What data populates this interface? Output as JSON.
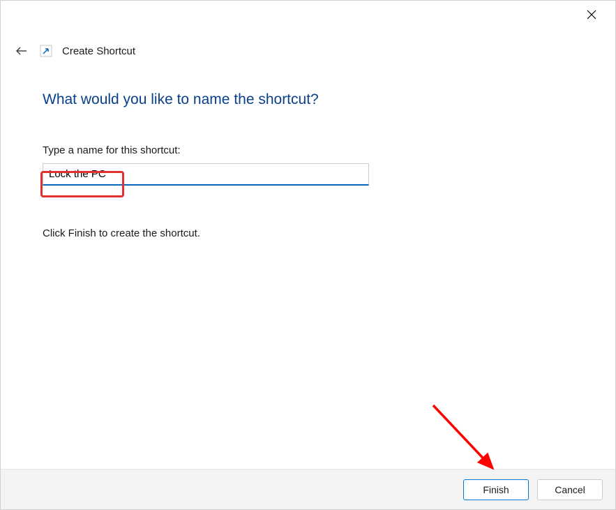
{
  "titlebar": {
    "close_tooltip": "Close"
  },
  "header": {
    "back_tooltip": "Back",
    "page_title": "Create Shortcut"
  },
  "content": {
    "heading": "What would you like to name the shortcut?",
    "field_label": "Type a name for this shortcut:",
    "input_value": "Lock the PC",
    "instruction": "Click Finish to create the shortcut."
  },
  "footer": {
    "finish_label": "Finish",
    "cancel_label": "Cancel"
  },
  "annotations": {
    "highlight_color": "#e03030",
    "arrow_color": "#ff0000"
  }
}
